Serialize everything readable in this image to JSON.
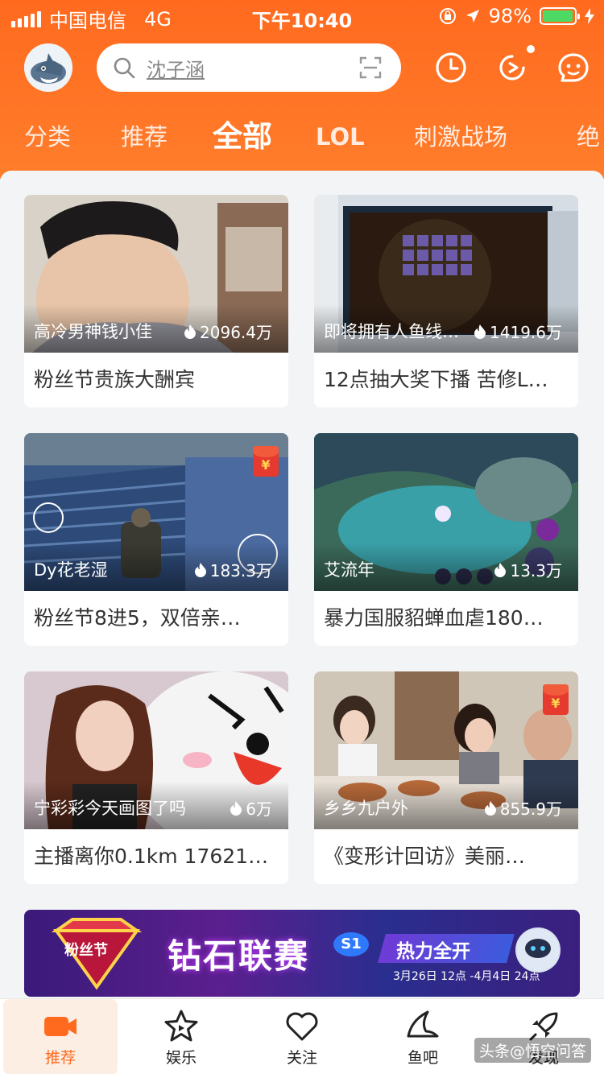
{
  "status": {
    "carrier": "中国电信",
    "network": "4G",
    "time": "下午10:40",
    "battery": "98%",
    "battery_level": 0.98
  },
  "search": {
    "placeholder": "沈子涵"
  },
  "tabs": [
    "分类",
    "推荐",
    "全部",
    "LOL",
    "刺激战场",
    "绝"
  ],
  "active_tab": "全部",
  "cards": [
    {
      "anchor": "高冷男神钱小佳",
      "views": "2096.4万",
      "title": "粉丝节贵族大酬宾"
    },
    {
      "anchor": "即将拥有人鱼线…",
      "views": "1419.6万",
      "title": "12点抽大奖下播 苦修L…"
    },
    {
      "anchor": "Dy花老湿",
      "views": "183.3万",
      "title": "粉丝节8进5，双倍亲…",
      "redpacket": true
    },
    {
      "anchor": "艾流年",
      "views": "13.3万",
      "title": "暴力国服貂蝉血虐180…"
    },
    {
      "anchor": "宁彩彩今天画图了吗",
      "views": "6万",
      "title": "主播离你0.1km 17621…"
    },
    {
      "anchor": "乡乡九户外",
      "views": "855.9万",
      "title": "《变形计回访》美丽…",
      "redpacket": true
    }
  ],
  "redpacket_symbol": "¥",
  "banner": {
    "badge": "粉丝节",
    "title": "钻石联赛",
    "season": "S1",
    "slogan": "热力全开",
    "dates": "3月26日 12点 -4月4日 24点"
  },
  "nav": [
    {
      "label": "推荐",
      "icon": "video-camera-icon",
      "active": true
    },
    {
      "label": "娱乐",
      "icon": "star-icon",
      "active": false
    },
    {
      "label": "关注",
      "icon": "heart-icon",
      "active": false
    },
    {
      "label": "鱼吧",
      "icon": "fish-fin-icon",
      "active": false
    },
    {
      "label": "发现",
      "icon": "rocket-icon",
      "active": false
    }
  ],
  "watermark": "头条@悟空问答",
  "colors": {
    "brand": "#ff6a1f",
    "active_tab_bg": "#fdeee4",
    "battery": "#4cd964",
    "redpacket": "#e63a2f"
  }
}
